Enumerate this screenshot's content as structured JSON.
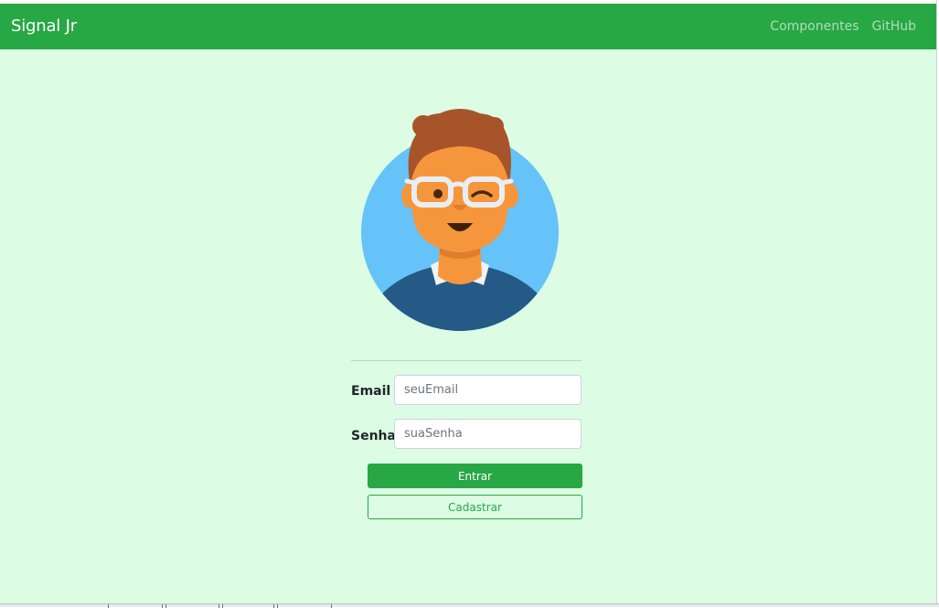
{
  "navbar": {
    "brand": "Signal Jr",
    "links": [
      {
        "label": "Componentes"
      },
      {
        "label": "GitHub"
      }
    ],
    "color": "#28a745"
  },
  "page": {
    "background": "#dcfce3"
  },
  "avatar": {
    "icon": "avatar-icon"
  },
  "form": {
    "email": {
      "label": "Email",
      "placeholder": "seuEmail",
      "value": ""
    },
    "password": {
      "label": "Senha",
      "placeholder": "suaSenha",
      "value": ""
    },
    "submit_label": "Entrar",
    "register_label": "Cadastrar"
  }
}
